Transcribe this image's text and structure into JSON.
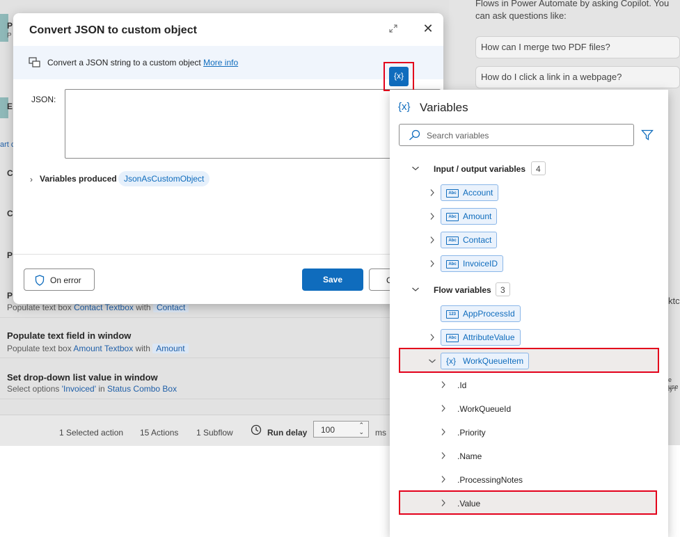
{
  "background": {
    "left_fragments": [
      "P",
      "P",
      "E",
      "art c",
      "C",
      "C",
      "C",
      "C",
      "P",
      "P",
      "P"
    ],
    "rows": [
      {
        "title": "",
        "sub_prefix": "Populate text box",
        "sub_link": "Contact Textbox",
        "sub_mid": "with",
        "sub_pill": "Contact"
      },
      {
        "title": "Populate text field in window",
        "sub_prefix": "Populate text box",
        "sub_link": "Amount Textbox",
        "sub_mid": "with",
        "sub_pill": "Amount"
      },
      {
        "title": "Set drop-down list value in window",
        "sub_prefix": "Select options",
        "sub_link": "'Invoiced'",
        "sub_mid": "in",
        "sub_pill": "Status Combo Box"
      }
    ],
    "copilot": {
      "intro_line1": "Flows in Power Automate by asking Copilot. You",
      "intro_line2": "can ask questions like:",
      "q1": "How can I merge two PDF files?",
      "q2": "How do I click a link in a webpage?",
      "frag_right1": "ktc",
      "frag_right2": "e use",
      "frag_right3": "ly i"
    },
    "status_bar": {
      "selected": "1 Selected action",
      "actions": "15 Actions",
      "subflow": "1 Subflow",
      "run_delay_label": "Run delay",
      "run_delay_value": "100",
      "unit": "ms"
    }
  },
  "dialog": {
    "title": "Convert JSON to custom object",
    "info_text": "Convert a JSON string to a custom object",
    "info_link": "More info",
    "json_label": "JSON:",
    "json_value": "",
    "vars_produced_label": "Variables produced",
    "vars_produced_pill": "JsonAsCustomObject",
    "on_error_label": "On error",
    "save_label": "Save",
    "cancel_label": "C",
    "fx_label": "{x}"
  },
  "variables_panel": {
    "title_icon": "{x}",
    "title": "Variables",
    "search_placeholder": "Search variables",
    "groups": [
      {
        "label": "Input / output variables",
        "count": "4"
      },
      {
        "label": "Flow variables",
        "count": "3"
      }
    ],
    "io_vars": [
      "Account",
      "Amount",
      "Contact",
      "InvoiceID"
    ],
    "flow_vars": [
      "AppProcessId",
      "AttributeValue",
      "WorkQueueItem"
    ],
    "type_labels": {
      "text": "Abc",
      "number": "123",
      "object": "{x}"
    },
    "properties": [
      ".Id",
      ".WorkQueueId",
      ".Priority",
      ".Name",
      ".ProcessingNotes",
      ".Value"
    ]
  },
  "colors": {
    "accent": "#0f6cbd",
    "highlight": "#e3001b"
  }
}
